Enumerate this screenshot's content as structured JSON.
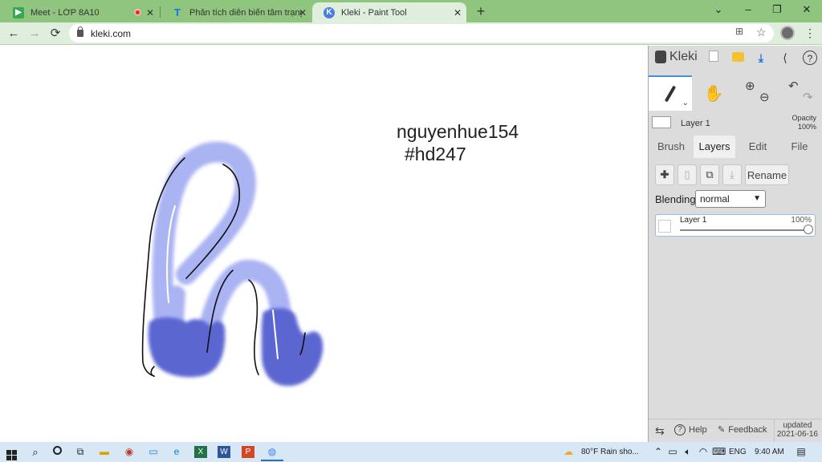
{
  "browser": {
    "tabs": [
      {
        "title": "Meet - LỚP 8A10",
        "favicon": "google-meet-icon",
        "recording": true
      },
      {
        "title": "Phân tích diễn biến tâm trạng cú...",
        "favicon": "text-t-icon"
      },
      {
        "title": "Kleki - Paint Tool",
        "favicon": "kleki-icon",
        "active": true
      }
    ],
    "url": "kleki.com",
    "new_tab": "+",
    "window_controls": {
      "chevron": "⌄",
      "minimize": "–",
      "restore": "❐",
      "close": "✕"
    },
    "nav": {
      "back": "←",
      "forward": "→",
      "reload": "⟳"
    }
  },
  "canvas": {
    "text_line1": "nguyenhue154",
    "text_line2": "#hd247",
    "colors": {
      "stroke_light": "#aab4f3",
      "stroke_dark": "#5c66d1",
      "outline": "#111111"
    }
  },
  "kleki": {
    "logo": "Kleki",
    "tools": [
      {
        "name": "brush",
        "active": true
      },
      {
        "name": "hand"
      },
      {
        "name": "zoom"
      },
      {
        "name": "undo-redo"
      }
    ],
    "layer_header": {
      "name": "Layer 1",
      "opacity_label": "Opacity",
      "opacity_value": "100%"
    },
    "tabs": [
      {
        "label": "Brush"
      },
      {
        "label": "Layers",
        "active": true
      },
      {
        "label": "Edit"
      },
      {
        "label": "File"
      }
    ],
    "layer_buttons": {
      "rename": "Rename"
    },
    "blending_label": "Blending",
    "blending_value": "normal",
    "layers": [
      {
        "name": "Layer 1",
        "opacity": "100%",
        "opacity_value": 1.0
      }
    ],
    "footer": {
      "help": "Help",
      "feedback": "Feedback",
      "updated_label": "updated",
      "updated_date": "2021-06-16"
    }
  },
  "taskbar": {
    "weather": "80°F  Rain sho...",
    "lang": "ENG",
    "time": "9:40 AM"
  },
  "accent_colors": {
    "browser_frame": "#90c57f",
    "toolbar": "#dfeedd",
    "taskbar": "#d7e7f6",
    "kleki_panel": "#dcdcdc"
  }
}
